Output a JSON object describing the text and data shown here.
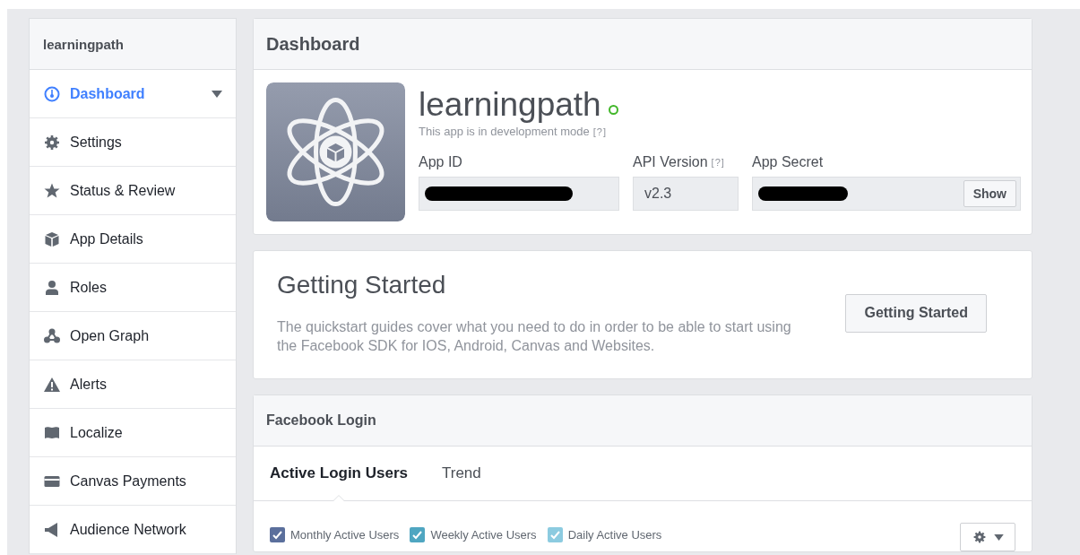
{
  "sidebar": {
    "title": "learningpath",
    "items": [
      {
        "label": "Dashboard",
        "selected": true,
        "dropdown": true
      },
      {
        "label": "Settings",
        "selected": false
      },
      {
        "label": "Status & Review",
        "selected": false
      },
      {
        "label": "App Details",
        "selected": false
      },
      {
        "label": "Roles",
        "selected": false
      },
      {
        "label": "Open Graph",
        "selected": false
      },
      {
        "label": "Alerts",
        "selected": false
      },
      {
        "label": "Localize",
        "selected": false
      },
      {
        "label": "Canvas Payments",
        "selected": false
      },
      {
        "label": "Audience Network",
        "selected": false
      }
    ]
  },
  "dashboard": {
    "title": "Dashboard",
    "app_name": "learningpath",
    "status": "This app is in development mode",
    "status_help": "[?]",
    "fields": [
      {
        "label": "App ID",
        "kind": "redacted"
      },
      {
        "label": "API Version",
        "help": "[?]",
        "kind": "text",
        "value": "v2.3"
      },
      {
        "label": "App Secret",
        "kind": "secret",
        "button": "Show"
      }
    ]
  },
  "getting_started": {
    "title": "Getting Started",
    "text": "The quickstart guides cover what you need to do in order to be able to start using the Facebook SDK for IOS, Android, Canvas and Websites.",
    "button": "Getting Started"
  },
  "facebook_login": {
    "title": "Facebook Login",
    "tabs": [
      {
        "label": "Active Login Users",
        "selected": true
      },
      {
        "label": "Trend",
        "selected": false
      }
    ],
    "series": [
      {
        "label": "Monthly Active Users",
        "checked": true,
        "color": "#5b6f9c"
      },
      {
        "label": "Weekly Active Users",
        "checked": true,
        "color": "#4fa6c1"
      },
      {
        "label": "Daily Active Users",
        "checked": true,
        "color": "#8ccbe0"
      }
    ]
  }
}
